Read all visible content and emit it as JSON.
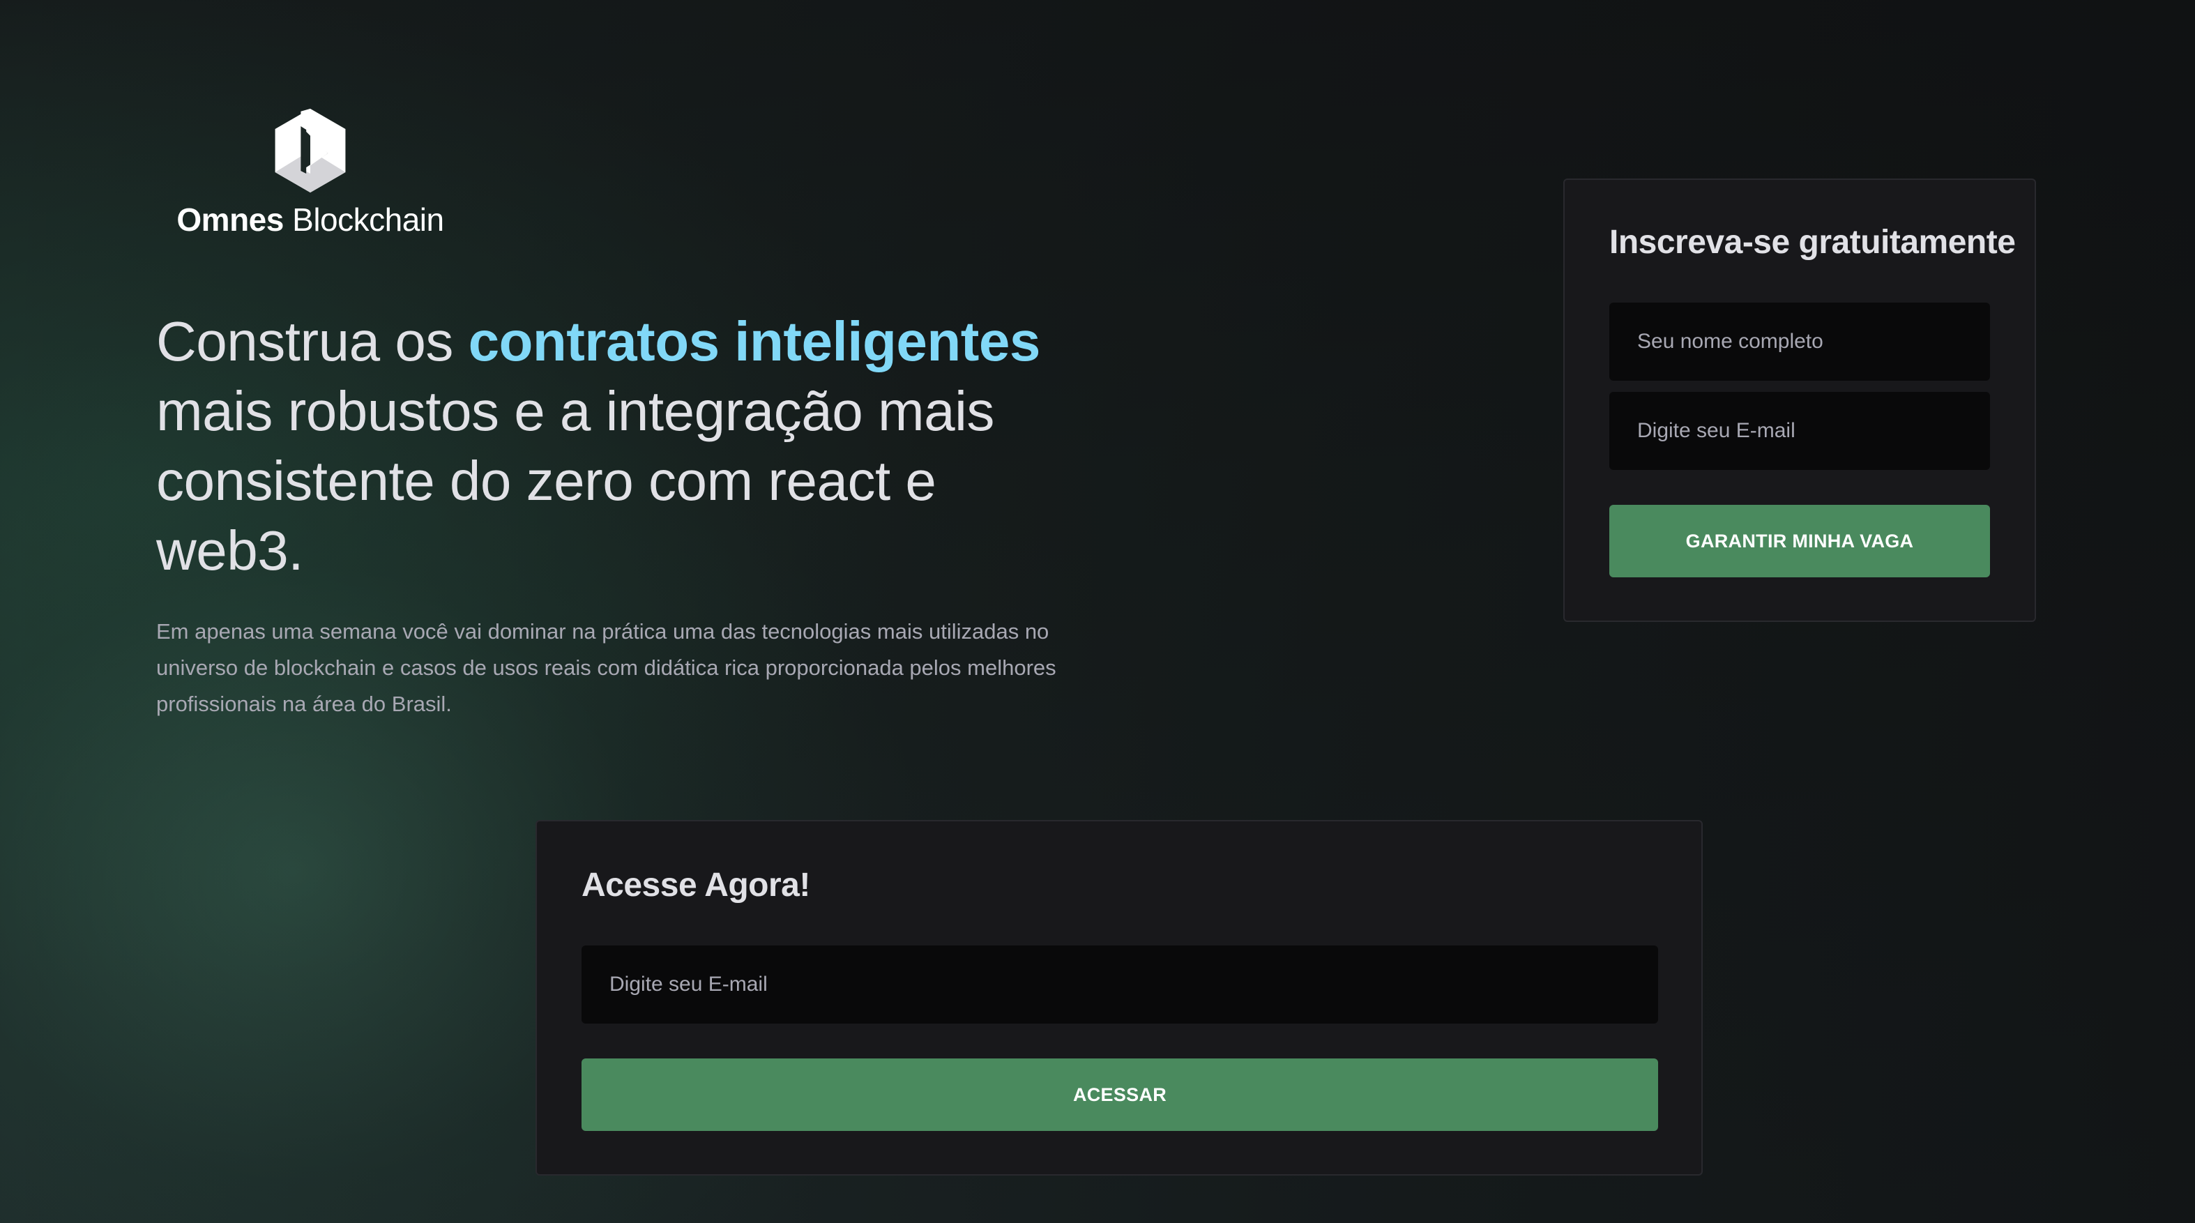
{
  "brand": {
    "name_bold": "Omnes",
    "name_light": "Blockchain",
    "logo_icon": "hexagon-play-logo"
  },
  "hero": {
    "headline_before": "Construa os ",
    "headline_highlight": "contratos inteligentes",
    "headline_after": " mais robustos e a integração mais consistente do zero com react e web3.",
    "description": "Em apenas uma semana você vai dominar na prática uma das tecnologias mais utilizadas no universo de blockchain e casos de usos reais com didática rica proporcionada pelos melhores profissionais na área do Brasil."
  },
  "signup": {
    "title": "Inscreva-se gratuitamente",
    "name_placeholder": "Seu nome completo",
    "email_placeholder": "Digite seu E-mail",
    "button_label": "GARANTIR MINHA VAGA"
  },
  "access": {
    "title": "Acesse Agora!",
    "email_placeholder": "Digite seu E-mail",
    "button_label": "ACESSAR"
  },
  "colors": {
    "highlight": "#81d8f7",
    "button": "#4a8a5e",
    "card": "#18181b",
    "input": "#09090a"
  }
}
